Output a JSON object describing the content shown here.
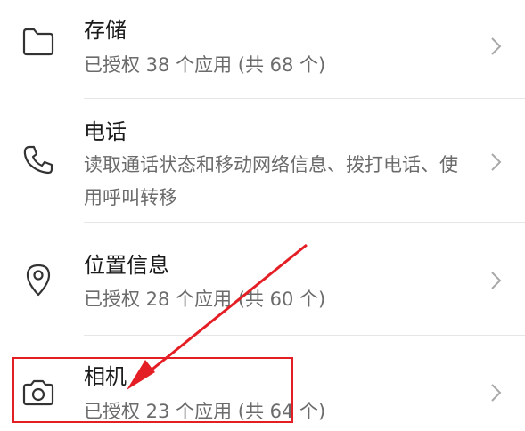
{
  "permissions": [
    {
      "icon": "folder-icon",
      "title": "存储",
      "subtitle": "已授权 38 个应用 (共 68 个)"
    },
    {
      "icon": "phone-icon",
      "title": "电话",
      "subtitle": "读取通话状态和移动网络信息、拨打电话、使用呼叫转移"
    },
    {
      "icon": "location-pin-icon",
      "title": "位置信息",
      "subtitle": "已授权 28 个应用 (共 60 个)"
    },
    {
      "icon": "camera-icon",
      "title": "相机",
      "subtitle": "已授权 23 个应用 (共 64 个)"
    }
  ],
  "annotation": {
    "arrow_color": "#e31e24",
    "highlight_color": "#e31e24"
  }
}
